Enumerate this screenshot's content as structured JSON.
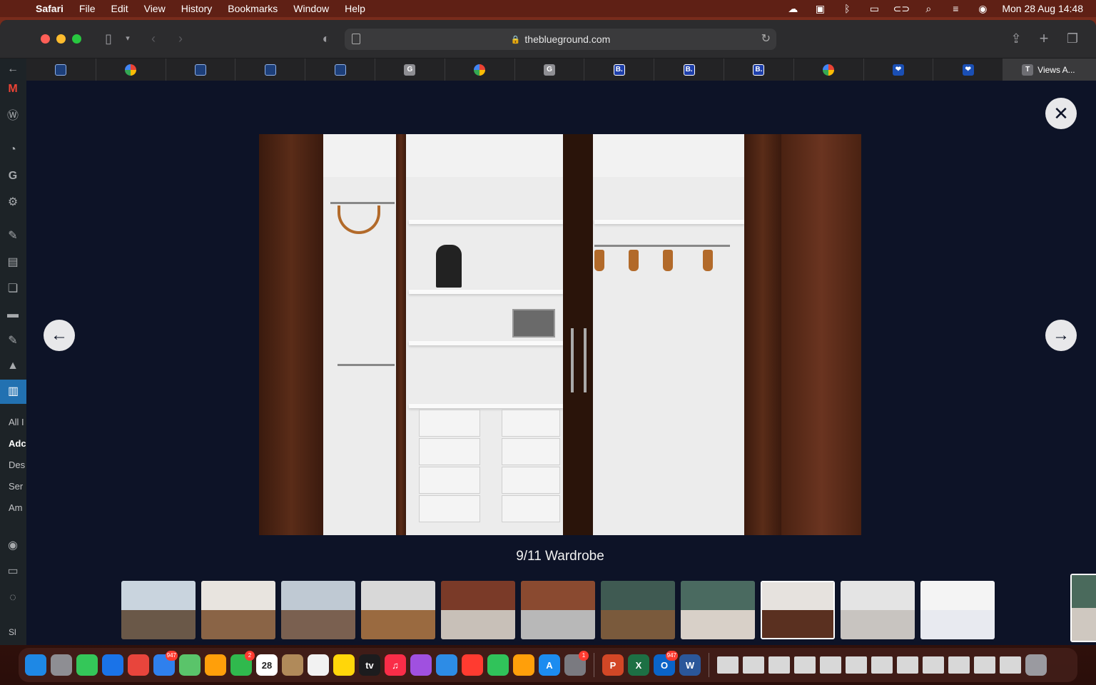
{
  "menubar": {
    "app": "Safari",
    "items": [
      "File",
      "Edit",
      "View",
      "History",
      "Bookmarks",
      "Window",
      "Help"
    ],
    "status_icons": [
      "icloud-icon",
      "outlook-icon",
      "bluetooth-icon",
      "battery-icon",
      "screen-mirror-icon",
      "search-icon",
      "control-center-icon",
      "siri-icon"
    ],
    "clock": "Mon 28 Aug  14:48"
  },
  "browser": {
    "url": "theblueground.com",
    "tabs": [
      {
        "icon": "blueground-grid-icon",
        "letter": ""
      },
      {
        "icon": "google-icon",
        "letter": ""
      },
      {
        "icon": "blueground-grid-icon",
        "letter": ""
      },
      {
        "icon": "blueground-grid-icon",
        "letter": ""
      },
      {
        "icon": "blueground-grid-icon",
        "letter": ""
      },
      {
        "icon": "grey-g-icon",
        "letter": "G"
      },
      {
        "icon": "google-icon",
        "letter": ""
      },
      {
        "icon": "grey-g-icon",
        "letter": "G"
      },
      {
        "icon": "booking-icon",
        "letter": "B."
      },
      {
        "icon": "booking-icon",
        "letter": "B."
      },
      {
        "icon": "booking-icon",
        "letter": "B."
      },
      {
        "icon": "google-icon",
        "letter": ""
      },
      {
        "icon": "heart-icon",
        "letter": "❤"
      },
      {
        "icon": "heart-icon",
        "letter": "❤"
      }
    ],
    "active_tab": {
      "letter": "T",
      "title": "Views A..."
    }
  },
  "wp_sidebar": {
    "labels": [
      "All I",
      "Adc",
      "Des",
      "Ser",
      "Am"
    ],
    "footer": "Sl"
  },
  "lightbox": {
    "caption": "9/11  Wardrobe",
    "close_symbol": "✕",
    "prev_symbol": "←",
    "next_symbol": "→",
    "thumbnails": [
      {
        "alt": "living-room-thumbnail",
        "top": "#c9d4de",
        "bottom": "#6a5848"
      },
      {
        "alt": "living-room-tv-thumbnail",
        "top": "#e8e4df",
        "bottom": "#8a6446"
      },
      {
        "alt": "living-room-window-thumbnail",
        "top": "#bfc9d3",
        "bottom": "#7a6050"
      },
      {
        "alt": "dining-thumbnail",
        "top": "#d8d8d8",
        "bottom": "#9a6a40"
      },
      {
        "alt": "kitchen-thumbnail",
        "top": "#7a3a28",
        "bottom": "#c8c0b8"
      },
      {
        "alt": "kitchen-counter-thumbnail",
        "top": "#8a4a30",
        "bottom": "#b8b8b8"
      },
      {
        "alt": "bedroom-green-thumbnail",
        "top": "#3f5a52",
        "bottom": "#7a5a3c"
      },
      {
        "alt": "bedroom-thumbnail",
        "top": "#4a6a60",
        "bottom": "#d8d0c8"
      },
      {
        "alt": "wardrobe-thumbnail",
        "top": "#e6e2de",
        "bottom": "#5a3020",
        "active": true
      },
      {
        "alt": "bathroom-thumbnail",
        "top": "#e4e4e4",
        "bottom": "#c8c4c0"
      },
      {
        "alt": "app-screenshot-thumbnail",
        "top": "#f4f4f4",
        "bottom": "#e8eaf0"
      }
    ],
    "preview_thumbnail": {
      "alt": "bedroom-preview-thumbnail",
      "top": "#4a6a5c",
      "bottom": "#cfc8c0"
    }
  },
  "dock": {
    "apps": [
      {
        "name": "finder-icon",
        "color": "#1e88e5",
        "label": ""
      },
      {
        "name": "launchpad-icon",
        "color": "#8e8e93",
        "label": ""
      },
      {
        "name": "messages-icon",
        "color": "#34c759",
        "label": ""
      },
      {
        "name": "safari-icon",
        "color": "#1a73e8",
        "label": ""
      },
      {
        "name": "chrome-icon",
        "color": "#e8453c",
        "label": ""
      },
      {
        "name": "mail-icon",
        "color": "#2f80ed",
        "label": "",
        "badge": "947"
      },
      {
        "name": "maps-icon",
        "color": "#5ac46a",
        "label": ""
      },
      {
        "name": "photos-icon",
        "color": "#ff9f0a",
        "label": ""
      },
      {
        "name": "facetime-icon",
        "color": "#30b94d",
        "label": "",
        "badge": "2"
      },
      {
        "name": "calendar-icon",
        "color": "#ffffff",
        "label": "28"
      },
      {
        "name": "contacts-icon",
        "color": "#b08a5a",
        "label": ""
      },
      {
        "name": "reminders-icon",
        "color": "#f2f2f2",
        "label": ""
      },
      {
        "name": "notes-icon",
        "color": "#ffd60a",
        "label": ""
      },
      {
        "name": "tv-icon",
        "color": "#1c1c1e",
        "label": "tv"
      },
      {
        "name": "music-icon",
        "color": "#fa2d48",
        "label": "♫"
      },
      {
        "name": "podcasts-icon",
        "color": "#a050e0",
        "label": ""
      },
      {
        "name": "keynote-icon",
        "color": "#2d8ce6",
        "label": ""
      },
      {
        "name": "news-icon",
        "color": "#ff3b30",
        "label": ""
      },
      {
        "name": "numbers-icon",
        "color": "#30c35a",
        "label": ""
      },
      {
        "name": "pages-icon",
        "color": "#ff9f0a",
        "label": ""
      },
      {
        "name": "app-store-icon",
        "color": "#1c8cf0",
        "label": "A"
      },
      {
        "name": "system-settings-icon",
        "color": "#7a7a80",
        "label": "",
        "badge": "1"
      },
      {
        "name": "powerpoint-icon",
        "color": "#d24726",
        "label": "P"
      },
      {
        "name": "excel-icon",
        "color": "#1d7044",
        "label": "X"
      },
      {
        "name": "outlook-icon",
        "color": "#0a64c8",
        "label": "O",
        "badge": "947"
      },
      {
        "name": "word-icon",
        "color": "#2b579a",
        "label": "W"
      }
    ]
  }
}
